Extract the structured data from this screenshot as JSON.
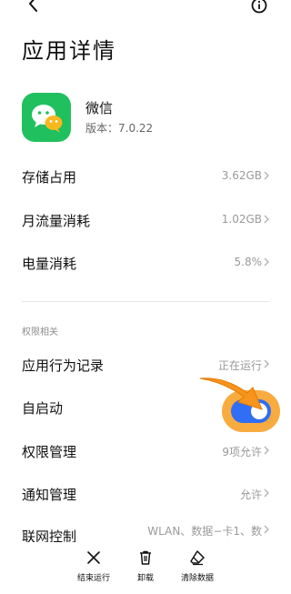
{
  "page_title": "应用详情",
  "app": {
    "name": "微信",
    "version": "版本：7.0.22"
  },
  "storage": {
    "label": "存储占用",
    "value": "3.62GB"
  },
  "traffic": {
    "label": "月流量消耗",
    "value": "1.02GB"
  },
  "battery": {
    "label": "电量消耗",
    "value": "5.8%"
  },
  "permissions_section": "权限相关",
  "behavior": {
    "label": "应用行为记录",
    "value": "正在运行"
  },
  "autostart": {
    "label": "自启动",
    "enabled": true
  },
  "perm_manage": {
    "label": "权限管理",
    "value": "9项允许"
  },
  "notify": {
    "label": "通知管理",
    "value": "允许"
  },
  "network": {
    "label": "联网控制",
    "value": "WLAN、数据−卡1、数"
  },
  "bottom_actions": {
    "stop": "结束运行",
    "uninstall": "卸载",
    "clear": "清除数据"
  },
  "colors": {
    "accent": "#2f6ef5",
    "wechat_green": "#20c05f",
    "highlight": "#f7a22a"
  }
}
